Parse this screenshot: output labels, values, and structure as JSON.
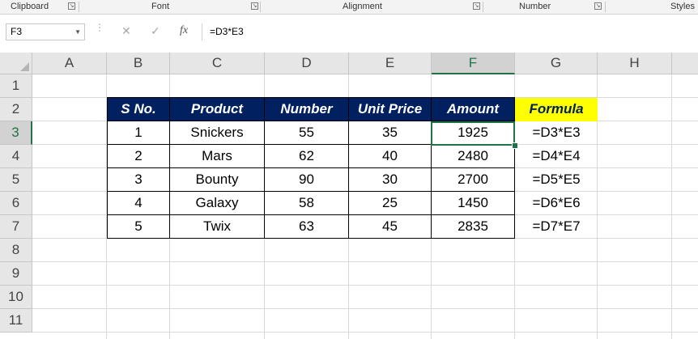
{
  "ribbon": {
    "groups": [
      "Clipboard",
      "Font",
      "Alignment",
      "Number",
      "Styles"
    ]
  },
  "formula_bar": {
    "name_box": "F3",
    "cancel_icon": "✕",
    "enter_icon": "✓",
    "function_icon": "fx",
    "formula": "=D3*E3"
  },
  "columns": [
    "A",
    "B",
    "C",
    "D",
    "E",
    "F",
    "G",
    "H"
  ],
  "rows": [
    "1",
    "2",
    "3",
    "4",
    "5",
    "6",
    "7",
    "8",
    "9",
    "10",
    "11"
  ],
  "table": {
    "headers": [
      "S No.",
      "Product",
      "Number",
      "Unit Price",
      "Amount"
    ],
    "formula_header": "Formula",
    "rows": [
      {
        "sno": "1",
        "product": "Snickers",
        "number": "55",
        "unit_price": "35",
        "amount": "1925",
        "formula": "=D3*E3"
      },
      {
        "sno": "2",
        "product": "Mars",
        "number": "62",
        "unit_price": "40",
        "amount": "2480",
        "formula": "=D4*E4"
      },
      {
        "sno": "3",
        "product": "Bounty",
        "number": "90",
        "unit_price": "30",
        "amount": "2700",
        "formula": "=D5*E5"
      },
      {
        "sno": "4",
        "product": "Galaxy",
        "number": "58",
        "unit_price": "25",
        "amount": "1450",
        "formula": "=D6*E6"
      },
      {
        "sno": "5",
        "product": "Twix",
        "number": "63",
        "unit_price": "45",
        "amount": "2835",
        "formula": "=D7*E7"
      }
    ]
  },
  "colors": {
    "header_fill": "#002060",
    "formula_header_fill": "#ffff00",
    "selection_green": "#217346"
  }
}
